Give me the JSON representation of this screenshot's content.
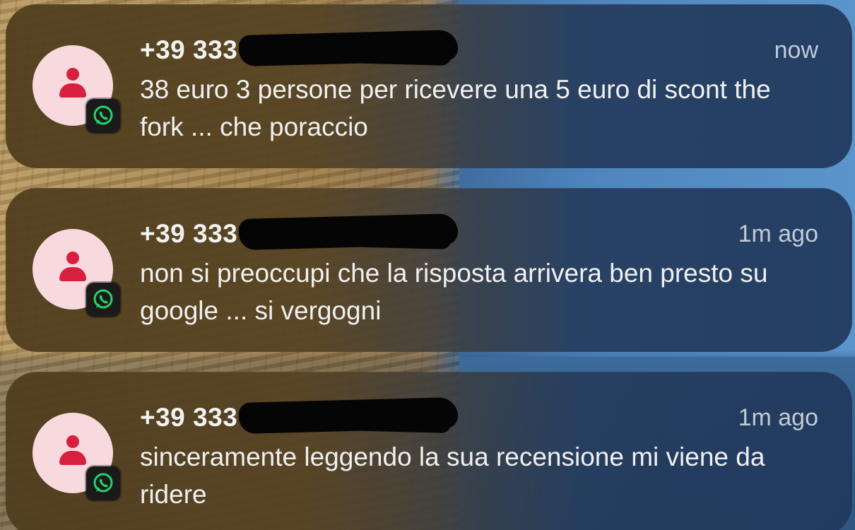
{
  "notifications": [
    {
      "sender": "+39 333",
      "time": "now",
      "message": "38 euro 3 persone per ricevere una 5 euro di scont the fork ... che poraccio",
      "app_icon": "whatsapp-icon",
      "avatar_icon": "person-icon"
    },
    {
      "sender": "+39 333",
      "time": "1m ago",
      "message": "non si preoccupi che la risposta arrivera ben presto su google ... si vergogni",
      "app_icon": "whatsapp-icon",
      "avatar_icon": "person-icon"
    },
    {
      "sender": "+39 333",
      "time": "1m ago",
      "message": "sinceramente leggendo la sua recensione mi viene da ridere",
      "app_icon": "whatsapp-icon",
      "avatar_icon": "person-icon"
    }
  ],
  "colors": {
    "avatar_bg": "#f7d9de",
    "avatar_person": "#d71f3f",
    "whatsapp_green": "#25d366",
    "time_text": "#c2cad6"
  }
}
